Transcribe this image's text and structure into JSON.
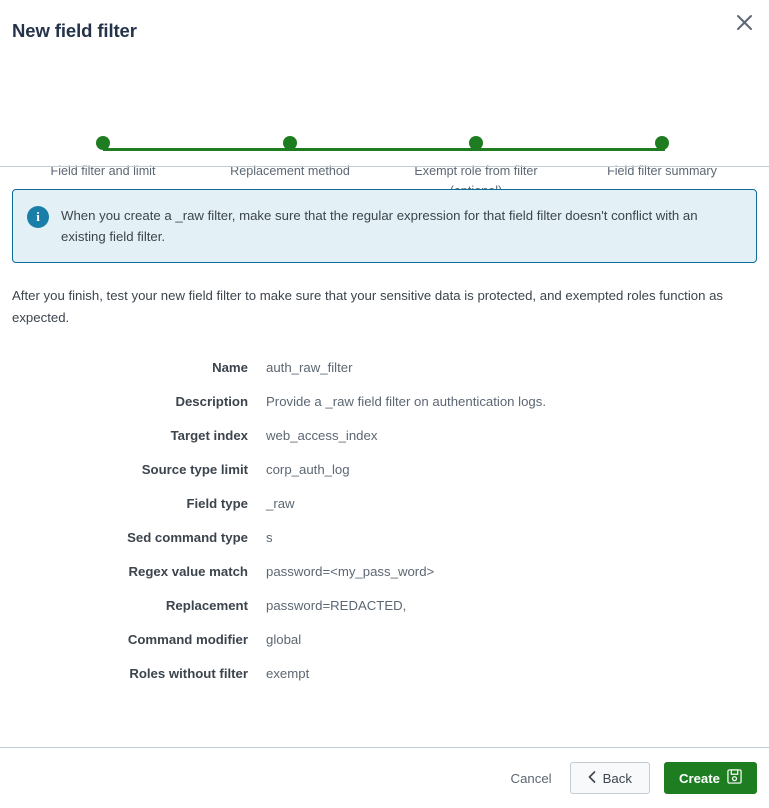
{
  "header": {
    "title": "New field filter",
    "close_icon": "close-icon"
  },
  "stepper": {
    "steps": [
      {
        "label": "Field filter and limit",
        "state": "complete"
      },
      {
        "label": "Replacement method",
        "state": "complete"
      },
      {
        "label": "Exempt role from filter\n(optional)",
        "state": "complete"
      },
      {
        "label": "Field filter summary",
        "state": "current"
      }
    ],
    "accent_color": "#1f7d21"
  },
  "banner": {
    "icon": "info-icon",
    "icon_glyph": "i",
    "text": "When you create a _raw filter, make sure that the regular expression for that field filter doesn't conflict with an existing field filter.",
    "background_color": "#e3f0f5",
    "border_color": "#0b6e99"
  },
  "note": "After you finish, test your new field filter to make sure that your sensitive data is protected, and exempted roles function as expected.",
  "summary": {
    "rows": [
      {
        "label": "Name",
        "value": "auth_raw_filter"
      },
      {
        "label": "Description",
        "value": "Provide a _raw field filter on authentication logs."
      },
      {
        "label": "Target index",
        "value": "web_access_index"
      },
      {
        "label": "Source type limit",
        "value": "corp_auth_log"
      },
      {
        "label": "Field type",
        "value": "_raw"
      },
      {
        "label": "Sed command type",
        "value": "s"
      },
      {
        "label": "Regex value match",
        "value": "password=<my_pass_word>"
      },
      {
        "label": "Replacement",
        "value": "password=REDACTED,"
      },
      {
        "label": "Command modifier",
        "value": "global"
      },
      {
        "label": "Roles without filter",
        "value": "exempt"
      }
    ]
  },
  "footer": {
    "cancel_label": "Cancel",
    "back_label": "Back",
    "back_icon": "chevron-left-icon",
    "create_label": "Create",
    "create_icon": "save-icon",
    "primary_color": "#1f7d21"
  }
}
